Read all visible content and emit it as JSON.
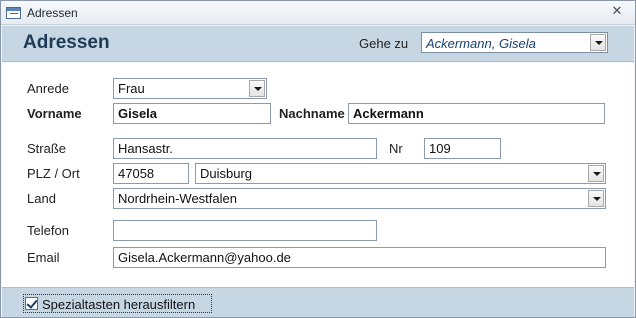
{
  "window": {
    "title": "Adressen",
    "close_symbol": "✕"
  },
  "header": {
    "title": "Adressen",
    "goto_label": "Gehe zu",
    "goto_value": "Ackermann, Gisela"
  },
  "form": {
    "anrede": {
      "label": "Anrede",
      "value": "Frau"
    },
    "vorname": {
      "label": "Vorname",
      "value": "Gisela"
    },
    "nachname": {
      "label": "Nachname",
      "value": "Ackermann"
    },
    "strasse": {
      "label": "Straße",
      "value": "Hansastr."
    },
    "nr": {
      "label": "Nr",
      "value": "109"
    },
    "plz_ort": {
      "label": "PLZ / Ort",
      "plz": "47058",
      "ort": "Duisburg"
    },
    "land": {
      "label": "Land",
      "value": "Nordrhein-Westfalen"
    },
    "telefon": {
      "label": "Telefon",
      "value": ""
    },
    "email": {
      "label": "Email",
      "value": "Gisela.Ackermann@yahoo.de"
    }
  },
  "footer": {
    "checkbox_label": "Spezialtasten herausfiltern",
    "checkbox_checked": true
  }
}
